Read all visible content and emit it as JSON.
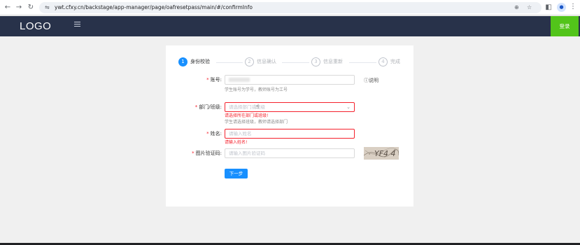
{
  "browser": {
    "back_icon": "back-arrow-icon",
    "forward_icon": "forward-arrow-icon",
    "reload_icon": "reload-icon",
    "url": "ywt.cfxy.cn/backstage/app-manager/page/oafresetpass/main/#/confirmInfo"
  },
  "header": {
    "logo_text": "LOGO",
    "login_label": "登录",
    "accent_color": "#52c41a",
    "bg_color": "#28324a"
  },
  "steps": [
    {
      "number": "1",
      "label": "身份校验"
    },
    {
      "number": "2",
      "label": "信息确认"
    },
    {
      "number": "3",
      "label": "信息重新"
    },
    {
      "number": "4",
      "label": "完成"
    }
  ],
  "form": {
    "account": {
      "label": "账号:",
      "value": "",
      "hint": "学生账号为学号，教师账号为工号",
      "explain": "说明"
    },
    "department": {
      "label": "部门/班级:",
      "placeholder": "请选择部门或班级",
      "error": "请选择所在部门或班级!",
      "hint": "学生请选择班级，教师请选择部门"
    },
    "name": {
      "label": "姓名:",
      "placeholder": "请输入姓名",
      "error": "请输入姓名!"
    },
    "captcha": {
      "label": "图片验证码:",
      "placeholder": "请输入图片验证码",
      "image_text": "YF4 4"
    },
    "next_label": "下一步"
  },
  "colors": {
    "primary": "#1890ff",
    "error": "#f5222d"
  }
}
